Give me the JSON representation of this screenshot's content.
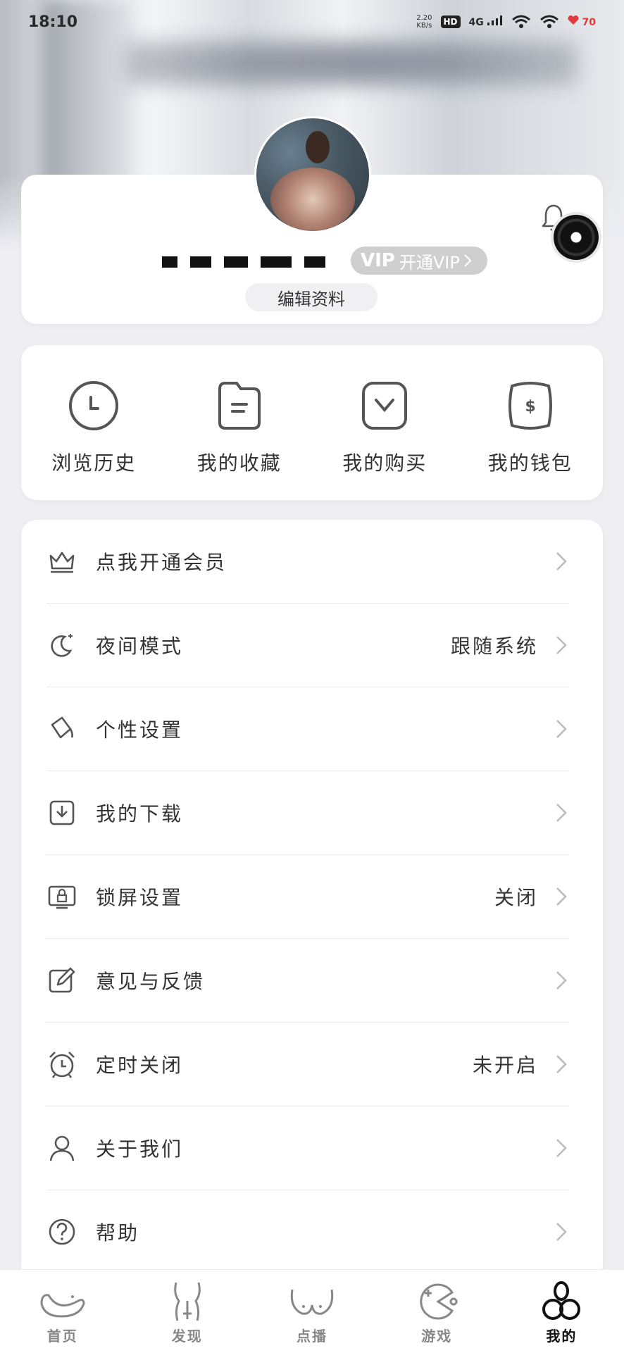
{
  "status_bar": {
    "time": "18:10",
    "net_speed": "2.20",
    "net_unit": "KB/s",
    "hd": "HD",
    "signal": "4G",
    "battery": "70"
  },
  "profile": {
    "vip_logo": "VIP",
    "vip_label": "开通VIP",
    "edit_label": "编辑资料"
  },
  "quick_actions": [
    {
      "label": "浏览历史",
      "icon": "clock-icon"
    },
    {
      "label": "我的收藏",
      "icon": "folder-icon"
    },
    {
      "label": "我的购买",
      "icon": "purchase-icon"
    },
    {
      "label": "我的钱包",
      "icon": "wallet-icon"
    }
  ],
  "menu": [
    {
      "label": "点我开通会员",
      "value": "",
      "icon": "crown-icon"
    },
    {
      "label": "夜间模式",
      "value": "跟随系统",
      "icon": "moon-icon"
    },
    {
      "label": "个性设置",
      "value": "",
      "icon": "paint-bucket-icon"
    },
    {
      "label": "我的下载",
      "value": "",
      "icon": "download-icon"
    },
    {
      "label": "锁屏设置",
      "value": "关闭",
      "icon": "lock-screen-icon"
    },
    {
      "label": "意见与反馈",
      "value": "",
      "icon": "edit-icon"
    },
    {
      "label": "定时关闭",
      "value": "未开启",
      "icon": "alarm-icon"
    },
    {
      "label": "关于我们",
      "value": "",
      "icon": "user-icon"
    },
    {
      "label": "帮助",
      "value": "",
      "icon": "help-icon"
    }
  ],
  "tabs": [
    {
      "label": "首页",
      "icon": "home-tab-icon",
      "active": false
    },
    {
      "label": "发现",
      "icon": "discover-tab-icon",
      "active": false
    },
    {
      "label": "点播",
      "icon": "vod-tab-icon",
      "active": false
    },
    {
      "label": "游戏",
      "icon": "game-tab-icon",
      "active": false
    },
    {
      "label": "我的",
      "icon": "mine-tab-icon",
      "active": true
    }
  ],
  "colors": {
    "page_bg": "#eeeef3",
    "card_bg": "#ffffff",
    "text": "#333333",
    "battery_red": "#e23b3b",
    "vip_pill": "#cfcfcf"
  }
}
